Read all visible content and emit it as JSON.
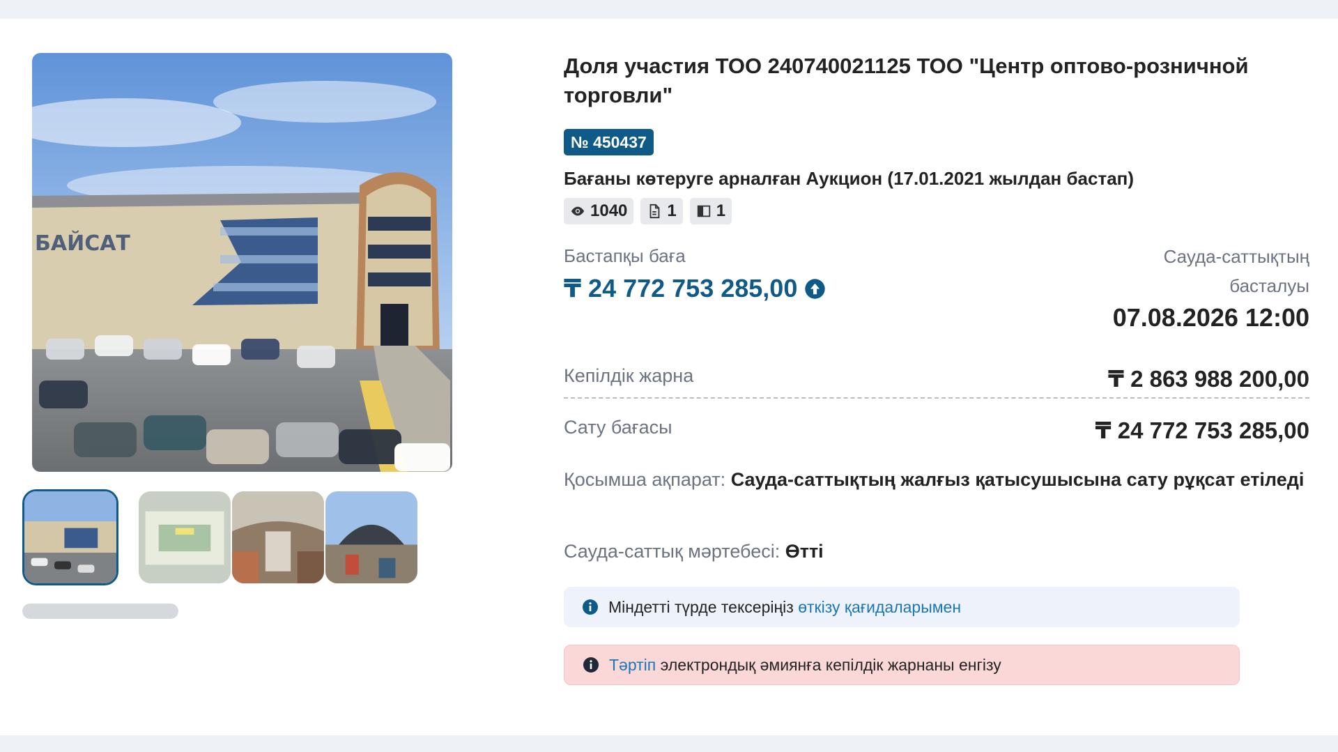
{
  "lot": {
    "title": "Доля участия ТОО 240740021125 ТОО \"Центр оптово-розничной торговли\"",
    "number": "№ 450437",
    "auction_type": "Бағаны көтеруге арналған Аукцион (17.01.2021 жылдан бастап)",
    "stats": {
      "views": "1040",
      "documents": "1",
      "photos": "1"
    },
    "start_price_label": "Бастапқы баға",
    "start_price": "₸ 24 772 753 285,00",
    "trade_start_label": "Сауда-саттықтың басталуы",
    "trade_start": "07.08.2026 12:00",
    "deposit_label": "Кепілдік жарна",
    "deposit": "₸ 2 863 988 200,00",
    "sale_price_label": "Сату бағасы",
    "sale_price": "₸ 24 772 753 285,00",
    "extra_label": "Қосымша ақпарат:",
    "extra_value": "Сауда-саттықтың жалғыз қатысушысына сату рұқсат етіледі",
    "status_label": "Сауда-саттық мәртебесі:",
    "status_value": "Өтті"
  },
  "alerts": {
    "info_text": "Міндетті түрде тексеріңіз",
    "info_link": "өткізу қағидаларымен",
    "warn_link": "Тәртіп",
    "warn_text": "электрондық әмиянға кепілдік жарнаны енгізу"
  },
  "gallery": {
    "main_sign": "БАЙСАТ",
    "thumbnails": [
      "building-exterior",
      "market-hall-interior",
      "market-arcade",
      "market-entrance"
    ],
    "active_index": 0
  },
  "colors": {
    "accent": "#0f5a86",
    "link": "#1b76b5",
    "info_bg": "#eef3fb",
    "warn_bg": "#fbd8d8"
  }
}
